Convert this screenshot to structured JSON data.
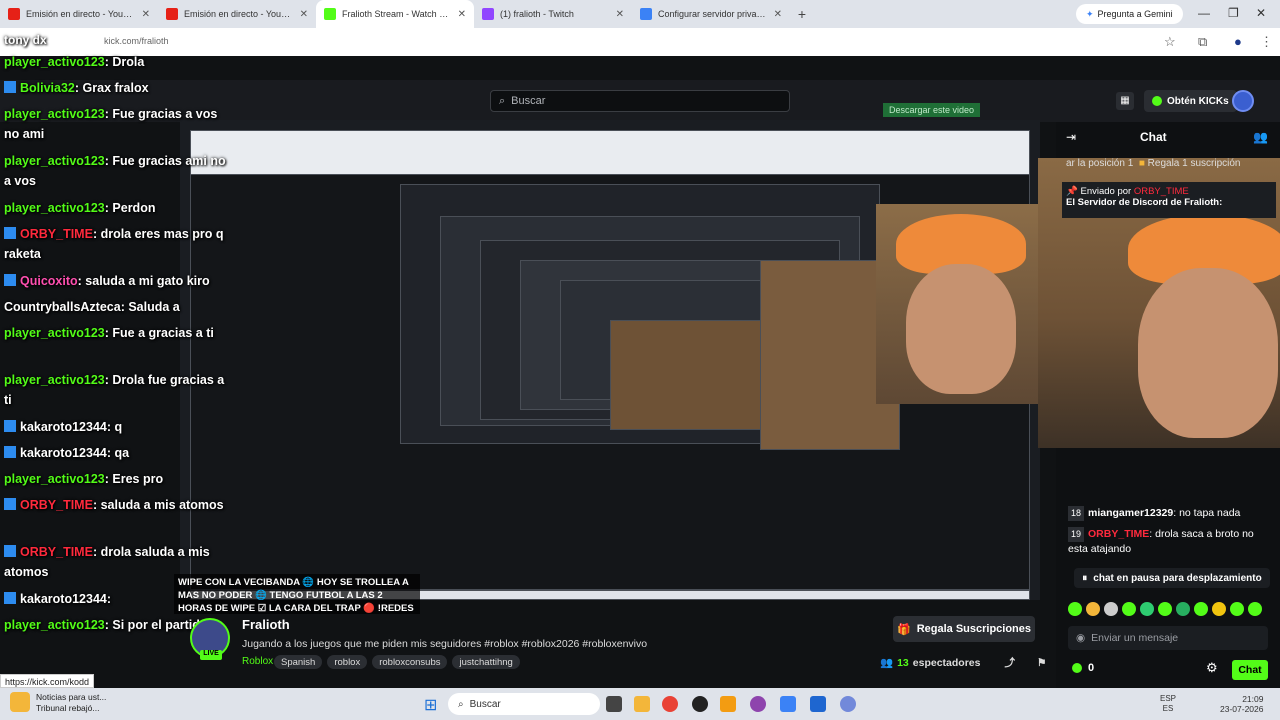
{
  "browser": {
    "tabs": [
      {
        "label": "Emisión en directo - YouTube S",
        "color": "#e62117"
      },
      {
        "label": "Emisión en directo - YouTube S",
        "color": "#e62117"
      },
      {
        "label": "Fralioth Stream - Watch Live on",
        "color": "#53fc18"
      },
      {
        "label": "(1) fralioth - Twitch",
        "color": "#9146ff"
      },
      {
        "label": "Configurar servidor privado - R",
        "color": "#3b82f6"
      }
    ],
    "gemini_label": "Pregunta a Gemini",
    "url": "kick.com/fralioth",
    "overlay_user": "tony dx"
  },
  "kick": {
    "search_placeholder": "Buscar",
    "get_kicks": "Obtén KICKs",
    "overlay_label": "Descargar este video",
    "chat_title": "Chat",
    "gift_line_1": "ar la posición 1",
    "gift_line_2": "Regala 1 suscripción",
    "pinned_by": "Enviado por",
    "pinned_user": "ORBY_TIME",
    "pinned_text": "El Servidor de Discord de Fralioth:",
    "paused": "chat en pausa para desplazamiento",
    "message_placeholder": "Enviar un mensaje",
    "kick_count": "0",
    "chat_button": "Chat"
  },
  "chat_lines_panel": [
    {
      "num": "18",
      "user": "miangamer12329",
      "text": ": no tapa nada",
      "color": "#fff"
    },
    {
      "num": "19",
      "user": "ORBY_TIME",
      "text": ": drola saca a broto no esta atajando",
      "color": "#ff2a3d"
    }
  ],
  "stream": {
    "name": "Fralioth",
    "title": "Jugando a los juegos que me piden mis seguidores #roblox #roblox2026 #robloxenvivo",
    "category": "Roblox",
    "tags": [
      "Spanish",
      "roblox",
      "robloxconsubs",
      "justchattihng"
    ],
    "gift_button": "Regala Suscripciones",
    "viewers_num": "13",
    "viewers_label": "espectadores",
    "live": "LIVE",
    "wipe_text": "WIPE CON LA VECIBANDA 🌐 HOY SE TROLLEA A MAS NO PODER 🌐 TENGO FUTBOL A LAS 2 HORAS DE WIPE ☑ LA CARA DEL TRAP 🔴 !REDES"
  },
  "overlay_chat": [
    {
      "user": "player_activo123",
      "text": ": Drola",
      "ucolor": "#53fc18",
      "badge": false
    },
    {
      "user": "Bolivia32",
      "text": ": Grax fralox",
      "ucolor": "#53fc18",
      "badge": true
    },
    {
      "user": "player_activo123",
      "text": ": Fue gracias a vos no ami",
      "ucolor": "#53fc18",
      "badge": false
    },
    {
      "user": "player_activo123",
      "text": ": Fue gracias ami no a vos",
      "ucolor": "#53fc18",
      "badge": false
    },
    {
      "user": "player_activo123",
      "text": ": Perdon",
      "ucolor": "#53fc18",
      "badge": false
    },
    {
      "user": "ORBY_TIME",
      "text": ": drola eres mas pro q raketa",
      "ucolor": "#ff2a3d",
      "badge": true
    },
    {
      "user": "Quicoxito",
      "text": ": saluda a mi gato kiro",
      "ucolor": "#ff4fb0",
      "badge": true
    },
    {
      "user": "CountryballsAzteca",
      "text": ": Saluda a",
      "ucolor": "#fff",
      "badge": false
    },
    {
      "user": "player_activo123",
      "text": ": Fue a gracias a ti",
      "ucolor": "#53fc18",
      "badge": false
    },
    {
      "user": "player_activo123",
      "text": ": Drola fue gracias a ti",
      "ucolor": "#53fc18",
      "badge": false
    },
    {
      "user": "kakaroto12344",
      "text": ": q",
      "ucolor": "#fff",
      "badge": true
    },
    {
      "user": "kakaroto12344",
      "text": ": qa",
      "ucolor": "#fff",
      "badge": true
    },
    {
      "user": "player_activo123",
      "text": ": Eres pro",
      "ucolor": "#53fc18",
      "badge": false
    },
    {
      "user": "ORBY_TIME",
      "text": ": saluda a mis atomos",
      "ucolor": "#ff2a3d",
      "badge": true
    },
    {
      "user": "ORBY_TIME",
      "text": ": drola saluda a mis atomos",
      "ucolor": "#ff2a3d",
      "badge": true
    },
    {
      "user": "kakaroto12344",
      "text": ":",
      "ucolor": "#fff",
      "badge": true
    },
    {
      "user": "player_activo123",
      "text": ": Si por el partido",
      "ucolor": "#53fc18",
      "badge": false
    }
  ],
  "status_url": "https://kick.com/kodd",
  "taskbar": {
    "news_1": "Noticias para ust...",
    "news_2": "Tribunal rebajó...",
    "search": "Buscar",
    "lang_1": "ESP",
    "lang_2": "ES",
    "time": "21:09",
    "date": "23-07-2026"
  }
}
